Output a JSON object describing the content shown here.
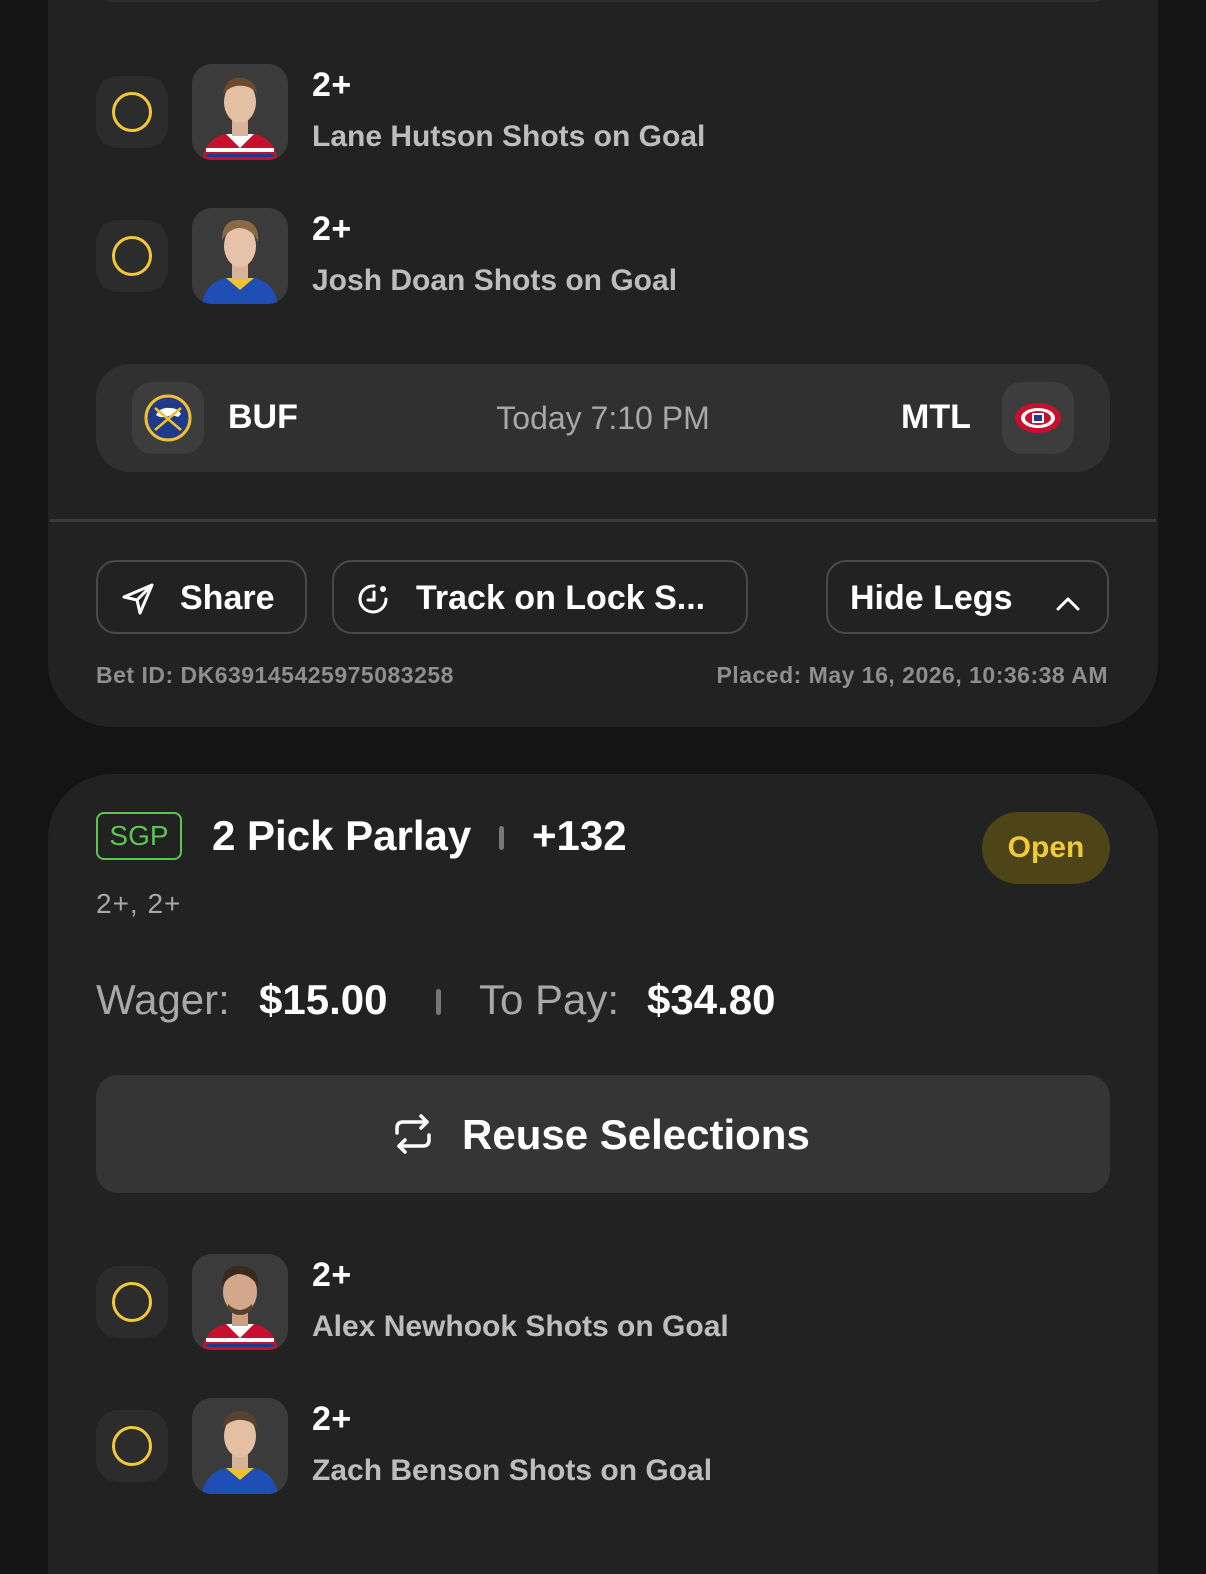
{
  "bet1": {
    "legs": [
      {
        "line": "2+",
        "market": "Lane Hutson Shots on Goal",
        "team": "MTL"
      },
      {
        "line": "2+",
        "market": "Josh Doan Shots on Goal",
        "team": "BUF"
      }
    ],
    "game": {
      "away": "BUF",
      "time": "Today 7:10 PM",
      "home": "MTL"
    },
    "actions": {
      "share": "Share",
      "track": "Track on Lock S...",
      "hide_legs": "Hide Legs"
    },
    "bet_id": "Bet ID: DK639145425975083258",
    "placed": "Placed: May 16, 2026, 10:36:38 AM"
  },
  "bet2": {
    "badge": "SGP",
    "title": "2 Pick Parlay",
    "odds": "+132",
    "status": "Open",
    "summary": "2+, 2+",
    "wager_label": "Wager:",
    "wager_value": "$15.00",
    "topay_label": "To Pay:",
    "topay_value": "$34.80",
    "reuse": "Reuse Selections",
    "legs": [
      {
        "line": "2+",
        "market": "Alex Newhook Shots on Goal",
        "team": "MTL"
      },
      {
        "line": "2+",
        "market": "Zach Benson Shots on Goal",
        "team": "BUF"
      }
    ]
  },
  "colors": {
    "background": "#141414",
    "card": "#222222",
    "accent_yellow": "#f0c83a",
    "sgp_green": "#5cc551",
    "mtl_red": "#c8102e",
    "buf_blue": "#1f4fb4"
  }
}
